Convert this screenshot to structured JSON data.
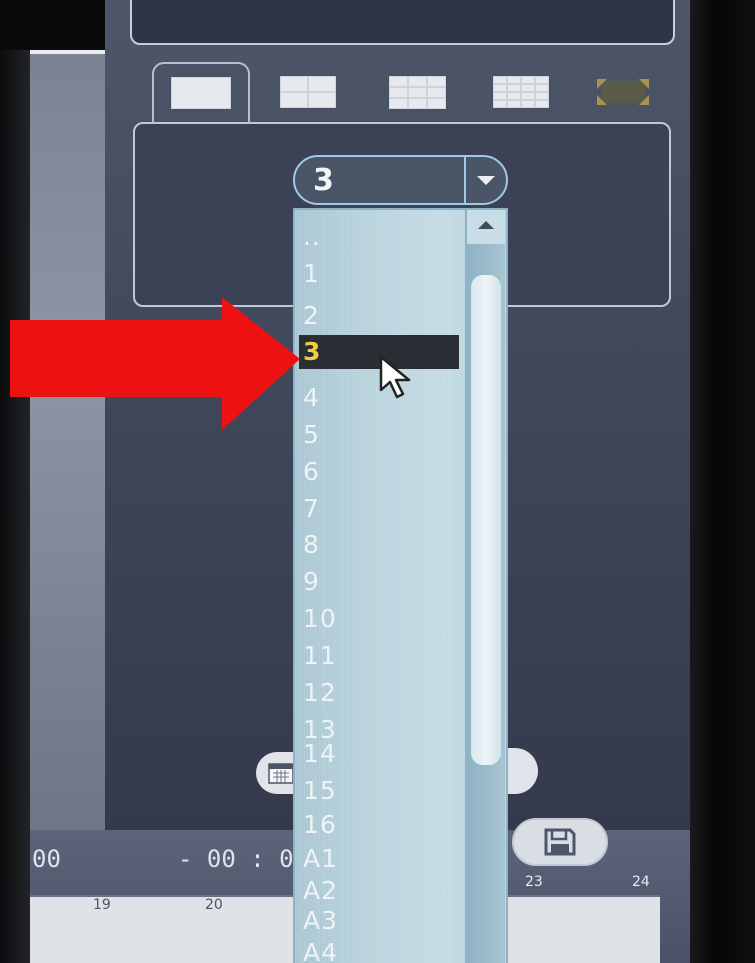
{
  "dropdown": {
    "selected_value": "3",
    "options": [
      {
        "label": ".."
      },
      {
        "label": "1"
      },
      {
        "label": "2"
      },
      {
        "label": "3",
        "selected": true
      },
      {
        "label": "4"
      },
      {
        "label": "5"
      },
      {
        "label": "6"
      },
      {
        "label": "7"
      },
      {
        "label": "8"
      },
      {
        "label": "9"
      },
      {
        "label": "10"
      },
      {
        "label": "11"
      },
      {
        "label": "12"
      },
      {
        "label": "13"
      },
      {
        "label": "14"
      },
      {
        "label": "15"
      },
      {
        "label": "16"
      },
      {
        "label": "A1"
      },
      {
        "label": "A2"
      },
      {
        "label": "A3"
      },
      {
        "label": "A4"
      }
    ]
  },
  "view_tabs": [
    {
      "icon": "single-view-icon",
      "active": true
    },
    {
      "icon": "quad-view-icon"
    },
    {
      "icon": "nine-view-icon"
    },
    {
      "icon": "sixteen-view-icon"
    },
    {
      "icon": "fit-screen-icon"
    }
  ],
  "playback": {
    "time_start": "00",
    "time_end": "- 00 : 0"
  },
  "timeline": {
    "hour_labels": [
      "19",
      "20",
      "23",
      "24"
    ]
  },
  "colors": {
    "selected_text": "#f3cd3a",
    "annotation_arrow": "#ee1111",
    "panel": "#3f4659"
  }
}
